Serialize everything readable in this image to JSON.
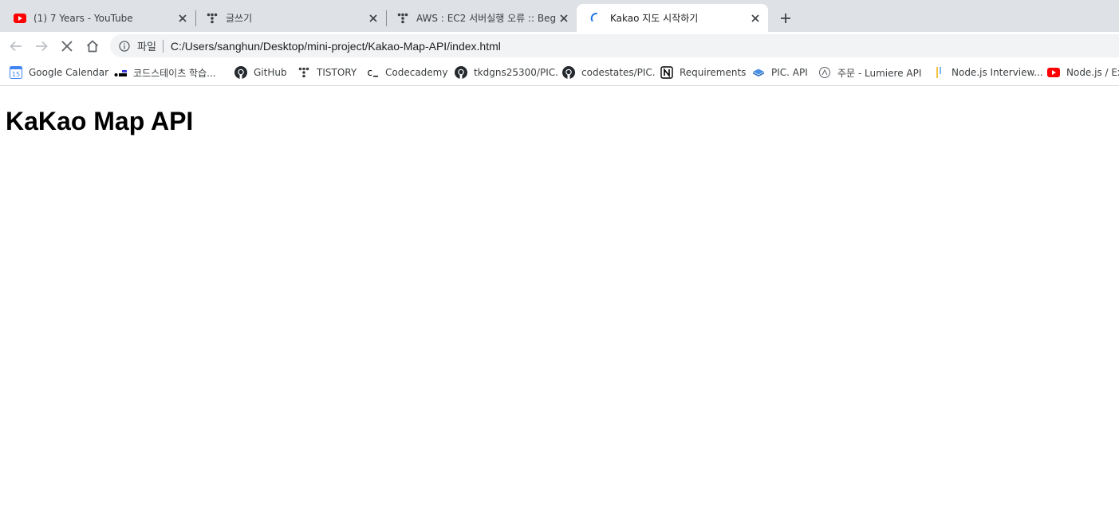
{
  "tabs": [
    {
      "title": "(1) 7 Years - YouTube",
      "icon": "youtube-icon",
      "active": false
    },
    {
      "title": "글쓰기",
      "icon": "tistory-icon",
      "active": false
    },
    {
      "title": "AWS : EC2 서버실행 오류 :: Beg",
      "icon": "tistory-icon",
      "active": false
    },
    {
      "title": "Kakao 지도 시작하기",
      "icon": "loading-icon",
      "active": true
    }
  ],
  "toolbar": {
    "scheme_chip": "파일",
    "url": "C:/Users/sanghun/Desktop/mini-project/Kakao-Map-API/index.html"
  },
  "bookmarks": [
    {
      "label": "Google Calendar",
      "icon": "google-calendar-icon"
    },
    {
      "label": "코드스테이츠 학습...",
      "icon": "codestates-icon"
    },
    {
      "label": "GitHub",
      "icon": "github-icon"
    },
    {
      "label": "TISTORY",
      "icon": "tistory-icon"
    },
    {
      "label": "Codecademy",
      "icon": "codecademy-icon"
    },
    {
      "label": "tkdgns25300/PIC.",
      "icon": "github-icon"
    },
    {
      "label": "codestates/PIC.",
      "icon": "github-icon"
    },
    {
      "label": "Requirements",
      "icon": "notion-icon"
    },
    {
      "label": "PIC. API",
      "icon": "pic-api-icon"
    },
    {
      "label": "주문 - Lumiere API",
      "icon": "lumiere-icon"
    },
    {
      "label": "Node.js Interview...",
      "icon": "nodejs-interview-icon"
    },
    {
      "label": "Node.js / Ex",
      "icon": "youtube-icon"
    }
  ],
  "page": {
    "heading": "KaKao Map API"
  },
  "colors": {
    "tabstrip_bg": "#dee1e6",
    "omnibox_bg": "#f1f3f4",
    "youtube_red": "#ff0000"
  }
}
